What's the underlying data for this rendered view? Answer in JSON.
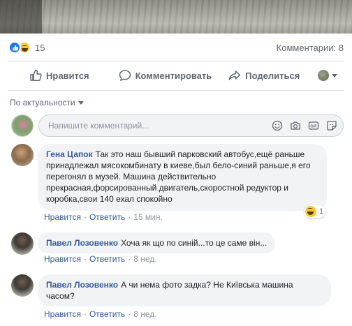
{
  "post": {
    "reaction_count": "15",
    "comments_count": "Комментарии: 8"
  },
  "actions": {
    "like": "Нравится",
    "comment": "Комментировать",
    "share": "Поделиться"
  },
  "sort": {
    "label": "По актуальности"
  },
  "composer": {
    "placeholder": "Напишите комментарий..."
  },
  "icons": [
    "like-icon",
    "haha-icon",
    "comment-icon",
    "share-icon",
    "emoji-icon",
    "camera-icon",
    "gif-icon",
    "sticker-icon",
    "caret-down-icon"
  ],
  "colors": {
    "link": "#385898",
    "like_blue": "#1877f2",
    "bubble_bg": "#f2f3f5",
    "meta_gray": "#606770"
  },
  "comments": [
    {
      "author": "Гена Цапок",
      "text": "Так это наш бывший парковский автобус,ещё раньше принадлежал мясокомбинату в киеве,был бело-синий раньше,я его перегонял в музей. Машина действительно прекрасная,форсированный двигатель,скоростной редуктор и коробка,свои 140 ехал спокойно",
      "like_label": "Нравится",
      "reply_label": "Ответить",
      "time": "15 мин.",
      "reaction_count": "1"
    },
    {
      "author": "Павел Лозовенко",
      "text": "Хоча як що по синій...то це саме він...",
      "like_label": "Нравится",
      "reply_label": "Ответить",
      "time": "8 нед."
    },
    {
      "author": "Павел Лозовенко",
      "text": "А чи нема фото задка? Не Київська машина часом?",
      "like_label": "Нравится",
      "reply_label": "Ответить",
      "time": "8 нед."
    }
  ]
}
